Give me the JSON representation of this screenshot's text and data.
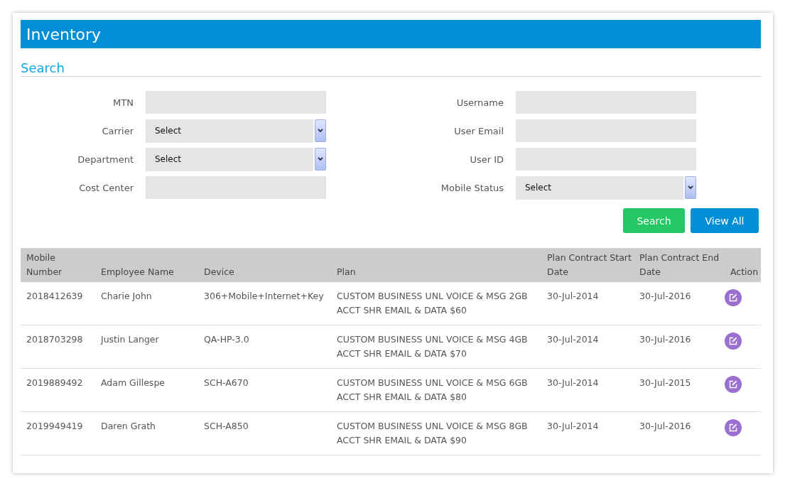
{
  "page": {
    "title": "Inventory"
  },
  "search": {
    "heading": "Search",
    "left_fields": [
      {
        "label": "MTN",
        "kind": "text"
      },
      {
        "label": "Carrier",
        "kind": "select",
        "value": "Select"
      },
      {
        "label": "Department",
        "kind": "select",
        "value": "Select"
      },
      {
        "label": "Cost Center",
        "kind": "text"
      }
    ],
    "right_fields": [
      {
        "label": "Username",
        "kind": "text"
      },
      {
        "label": "User Email",
        "kind": "text"
      },
      {
        "label": "User ID",
        "kind": "text"
      },
      {
        "label": "Mobile Status",
        "kind": "select",
        "value": "Select"
      }
    ],
    "buttons": [
      {
        "label": "Search",
        "kind": "primary"
      },
      {
        "label": "View All",
        "kind": "secondary"
      }
    ]
  },
  "table": {
    "columns": [
      "Mobile Number",
      "Employee Name",
      "Device",
      "Plan",
      "Plan Contract Start Date",
      "Plan Contract End Date",
      "Action"
    ],
    "rows": [
      {
        "mobile_number": "2018412639",
        "employee_name": "Charie John",
        "device": "306+Mobile+Internet+Key",
        "plan": "CUSTOM BUSINESS UNL VOICE & MSG 2GB ACCT SHR EMAIL & DATA $60",
        "start_date": "30-Jul-2014",
        "end_date": "30-Jul-2016"
      },
      {
        "mobile_number": "2018703298",
        "employee_name": "Justin Langer",
        "device": "QA-HP-3.0",
        "plan": "CUSTOM BUSINESS UNL VOICE & MSG 4GB ACCT SHR EMAIL & DATA $70",
        "start_date": "30-Jul-2014",
        "end_date": "30-Jul-2016"
      },
      {
        "mobile_number": "2019889492",
        "employee_name": "Adam Gillespe",
        "device": "SCH-A670",
        "plan": "CUSTOM BUSINESS UNL VOICE & MSG 6GB ACCT SHR EMAIL & DATA $80",
        "start_date": "30-Jul-2014",
        "end_date": "30-Jul-2015"
      },
      {
        "mobile_number": "2019949419",
        "employee_name": "Daren Grath",
        "device": "SCH-A850",
        "plan": "CUSTOM BUSINESS UNL VOICE & MSG 8GB ACCT SHR EMAIL & DATA $90",
        "start_date": "30-Jul-2014",
        "end_date": "30-Jul-2016"
      }
    ]
  }
}
